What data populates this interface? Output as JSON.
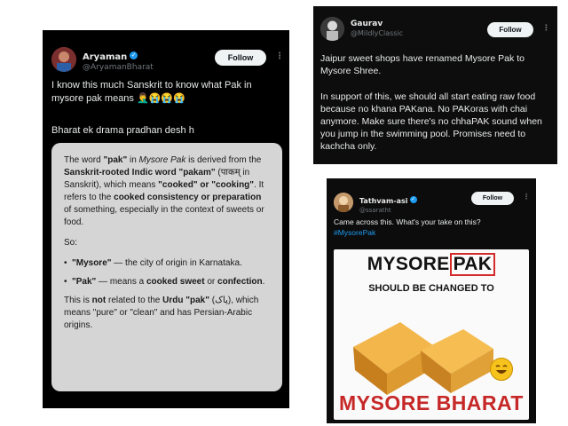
{
  "tweet1": {
    "name": "Aryaman",
    "handle": "@AryamanBharat",
    "follow_label": "Follow",
    "text1": "I know this much Sanskrit to know what Pak in mysore pak means 🤦‍♂️😭😭😭",
    "text2": "Bharat ek drama pradhan desh h",
    "answer": {
      "p1_a": "The word ",
      "p1_b": "\"pak\"",
      "p1_c": " in ",
      "p1_d": "Mysore Pak",
      "p1_e": " is derived from the ",
      "p1_f": "Sanskrit-rooted Indic word \"pakam\"",
      "p1_g": " (पाकम् in Sanskrit), which means ",
      "p1_h": "\"cooked\" or \"cooking\"",
      "p1_i": ". It refers to the ",
      "p1_j": "cooked consistency or preparation",
      "p1_k": " of something, especially in the context of sweets or food.",
      "so": "So:",
      "li1_a": "\"Mysore\"",
      "li1_b": " — the city of origin in Karnataka.",
      "li2_a": "\"Pak\"",
      "li2_b": " — means a ",
      "li2_c": "cooked sweet",
      "li2_d": " or ",
      "li2_e": "confection",
      "li2_f": ".",
      "p3_a": "This is ",
      "p3_b": "not",
      "p3_c": " related to the ",
      "p3_d": "Urdu \"pak\"",
      "p3_e": " (پاک), which means \"pure\" or \"clean\" and has Persian-Arabic origins."
    }
  },
  "tweet2": {
    "name": "Gaurav",
    "handle": "@MildlyClassic",
    "follow_label": "Follow",
    "text1": "Jaipur sweet shops have renamed Mysore Pak to Mysore Shree.",
    "text2": "In support of this, we should all start eating raw food because no khana PAKana. No PAKoras with chai anymore. Make sure there's no chhaPAK sound when you jump in the swimming pool. Promises need to kachcha only."
  },
  "tweet3": {
    "name": "Tathvam-asi",
    "handle": "@ssaratht",
    "follow_label": "Follow",
    "text1": "Came across this. What's your take on this?",
    "hashtag": "#MysorePak",
    "meme": {
      "top_a": "MYSORE",
      "top_b": "PAK",
      "middle": "SHOULD BE CHANGED TO",
      "bottom": "MYSORE BHARAT"
    }
  },
  "colors": {
    "card_bg": "#000000",
    "answer_bg": "#d6d5d6",
    "link": "#1d9bf0",
    "meme_red": "#c62828"
  }
}
